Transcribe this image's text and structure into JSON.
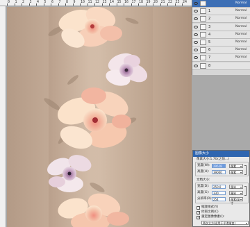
{
  "ruler": {
    "top_labels": [
      "0",
      "1",
      "2",
      "3",
      "4",
      "5",
      "6",
      "7",
      "8",
      "9",
      "10",
      "11",
      "12",
      "13",
      "14",
      "15",
      "16",
      "17",
      "18",
      "19",
      "20",
      "21",
      "22",
      "23",
      "24",
      "25"
    ]
  },
  "layers": {
    "rows": [
      {
        "name": "",
        "mode": "Normal",
        "selected": true
      },
      {
        "name": "1",
        "mode": "Normal",
        "selected": false
      },
      {
        "name": "2",
        "mode": "Normal",
        "selected": false
      },
      {
        "name": "3",
        "mode": "Normal",
        "selected": false
      },
      {
        "name": "4",
        "mode": "Normal",
        "selected": false
      },
      {
        "name": "5",
        "mode": "Normal",
        "selected": false
      },
      {
        "name": "6",
        "mode": "Normal",
        "selected": false
      },
      {
        "name": "7",
        "mode": "Normal",
        "selected": false
      },
      {
        "name": "8",
        "mode": "",
        "selected": false
      }
    ]
  },
  "dialog": {
    "title": "图像大小",
    "pixel_size": "像素大小:1.7G(之前...)",
    "width_label": "宽度(W):",
    "width_value": "29528",
    "width_unit": "像素",
    "height_label": "高度(H):",
    "height_value": "39000",
    "height_unit": "像素",
    "doc_size": "文档大小:",
    "doc_width_label": "宽度(D):",
    "doc_width_value": "250.0",
    "doc_width_unit": "厘米",
    "doc_height_label": "高度(G):",
    "doc_height_value": "330",
    "doc_height_unit": "厘米",
    "resolution_label": "分辨率(R):",
    "resolution_value": "254",
    "resolution_unit": "像素/英寸",
    "scale_styles": "缩放样式(Y)",
    "constrain": "约束比例(C)",
    "resample": "重定图像像素(I):",
    "resample_method": "两次立方(适用于平滑渐变)"
  },
  "colors": {
    "selection": "#3d6fb5",
    "dialog_title": "#2f66b0",
    "canvas_bg": "#c6ae9a"
  }
}
